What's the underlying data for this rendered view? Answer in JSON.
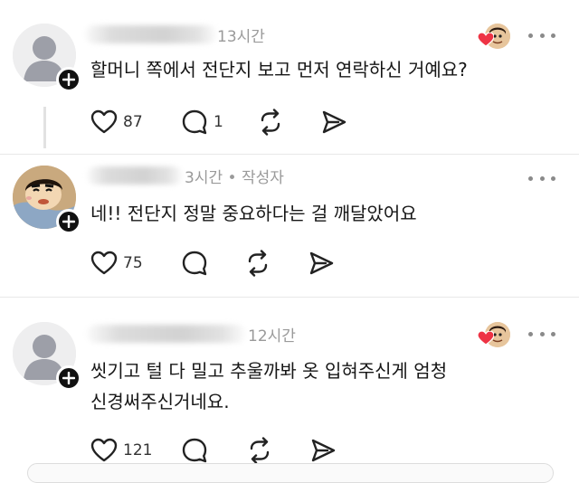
{
  "comments": [
    {
      "time": "13시간",
      "author_suffix": "",
      "text_lines": [
        "할머니 쪽에서 전단지 보고 먼저 연락하신 거예요?"
      ],
      "likes": "87",
      "replies": "1",
      "author_liked": true
    },
    {
      "time": "3시간",
      "author_suffix": "• 작성자",
      "text_lines": [
        "네!! 전단지 정말 중요하다는 걸 깨달았어요"
      ],
      "likes": "75",
      "replies": "",
      "author_liked": false
    },
    {
      "time": "12시간",
      "author_suffix": "",
      "text_lines": [
        "씻기고 털 다 밀고 추울까봐 옷 입혀주신게 엄청",
        "신경써주신거네요."
      ],
      "likes": "121",
      "replies": "",
      "author_liked": true
    }
  ],
  "icons": {
    "like": "heart-outline-icon",
    "reply": "speech-bubble-icon",
    "repost": "repost-arrows-icon",
    "share": "send-paper-plane-icon",
    "more": "more-horizontal-icon",
    "follow": "plus-icon",
    "liked_badge": "heart-filled-icon"
  },
  "colors": {
    "heart_red": "#ee3344",
    "text": "#161616",
    "muted": "#9a9a9a",
    "icon": "#222222"
  }
}
